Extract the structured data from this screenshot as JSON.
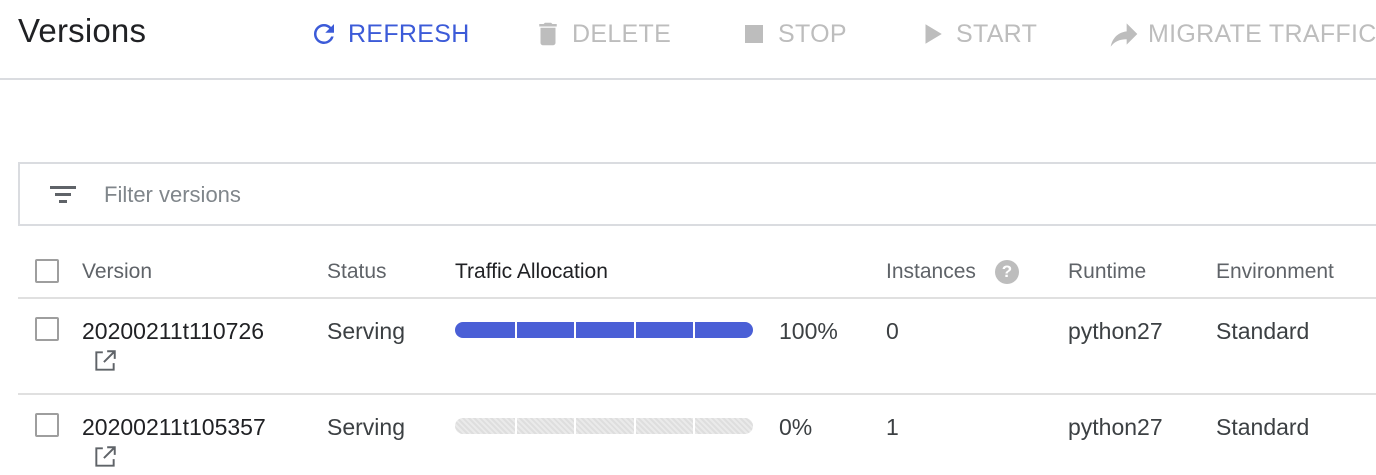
{
  "toolbar": {
    "title": "Versions",
    "refresh_label": "REFRESH",
    "delete_label": "DELETE",
    "stop_label": "STOP",
    "start_label": "START",
    "migrate_label": "MIGRATE TRAFFIC"
  },
  "filter": {
    "placeholder": "Filter versions"
  },
  "table": {
    "headers": {
      "version": "Version",
      "status": "Status",
      "traffic": "Traffic Allocation",
      "instances": "Instances",
      "runtime": "Runtime",
      "environment": "Environment"
    },
    "rows": [
      {
        "version": "20200211t110726",
        "status": "Serving",
        "traffic_fraction": 1.0,
        "traffic_label": "100%",
        "instances": "0",
        "runtime": "python27",
        "environment": "Standard"
      },
      {
        "version": "20200211t105357",
        "status": "Serving",
        "traffic_fraction": 0.0,
        "traffic_label": "0%",
        "instances": "1",
        "runtime": "python27",
        "environment": "Standard"
      }
    ]
  },
  "colors": {
    "accent": "#3c5bd8",
    "traffic_fill": "#4a5fd6",
    "disabled": "#bdbdbd",
    "divider": "#dadce0"
  }
}
